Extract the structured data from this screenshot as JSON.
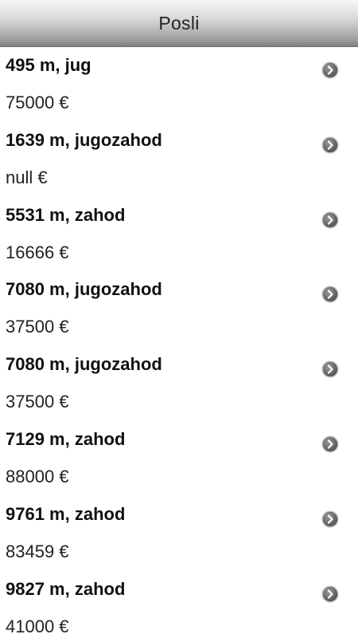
{
  "header": {
    "title": "Posli"
  },
  "list": {
    "items": [
      {
        "title": "495 m, jug",
        "price": "75000 €"
      },
      {
        "title": "1639 m, jugozahod",
        "price": "null €"
      },
      {
        "title": "5531 m, zahod",
        "price": "16666 €"
      },
      {
        "title": "7080 m, jugozahod",
        "price": "37500 €"
      },
      {
        "title": "7080 m, jugozahod",
        "price": "37500 €"
      },
      {
        "title": "7129 m, zahod",
        "price": "88000 €"
      },
      {
        "title": "9761 m, zahod",
        "price": "83459 €"
      },
      {
        "title": "9827 m, zahod",
        "price": "41000 €"
      }
    ],
    "item_icon": "chevron-right-circle-icon"
  }
}
